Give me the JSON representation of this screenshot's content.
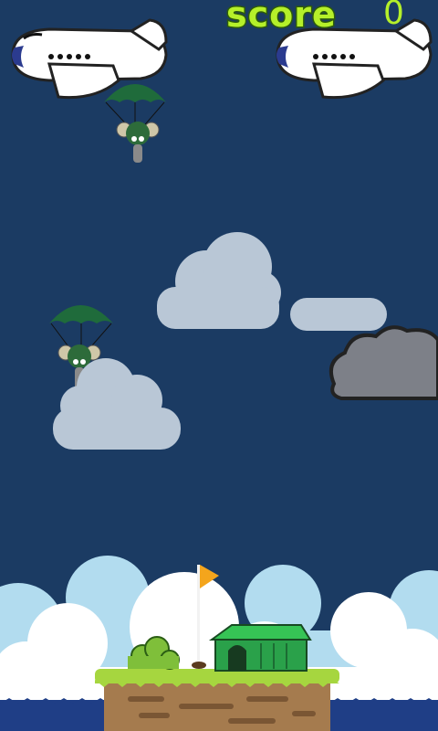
{
  "hud": {
    "score_label": "score",
    "score_value": "0"
  },
  "colors": {
    "sky": "#1b3b63",
    "cloud_light": "#b9c7d6",
    "cloud_dark": "#7d8088",
    "score_text": "#b5f02a",
    "parachute": "#1f6b3b",
    "ground_grass": "#a6d63f",
    "ground_dirt": "#a57b4e",
    "hut": "#2aa14a",
    "flag": "#f4a51c",
    "sea": "#1f3e86"
  },
  "sprites": {
    "planes": [
      "airplane",
      "airplane"
    ],
    "paratroopers": [
      "koala-parachutist",
      "koala-parachutist"
    ],
    "clouds": [
      "cloud",
      "cloud",
      "cloud",
      "storm-cloud"
    ],
    "base": [
      "island",
      "hut",
      "flag",
      "bush"
    ]
  }
}
